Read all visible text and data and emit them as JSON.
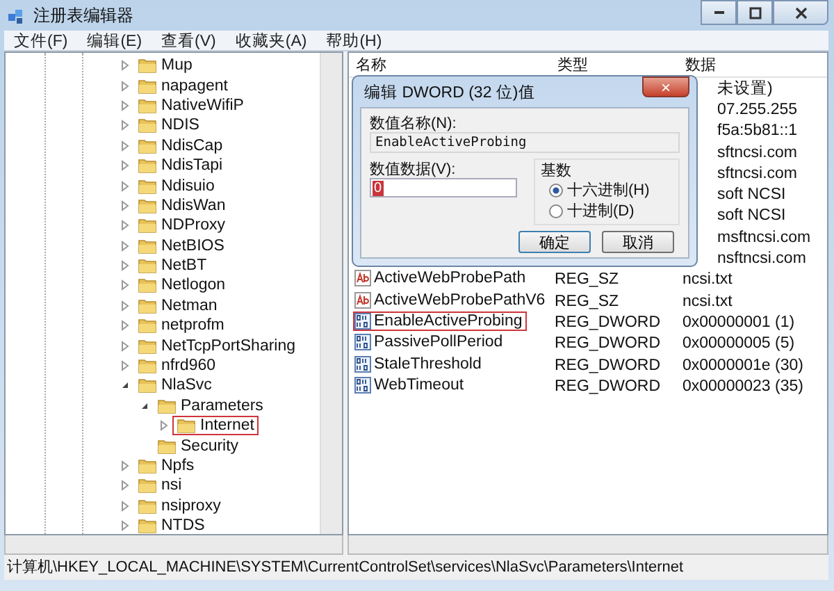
{
  "window": {
    "title": "注册表编辑器"
  },
  "menu": [
    "文件(F)",
    "编辑(E)",
    "查看(V)",
    "收藏夹(A)",
    "帮助(H)"
  ],
  "tree": [
    {
      "label": "Mup",
      "expanded": false
    },
    {
      "label": "napagent",
      "expanded": false
    },
    {
      "label": "NativeWifiP",
      "expanded": false
    },
    {
      "label": "NDIS",
      "expanded": false
    },
    {
      "label": "NdisCap",
      "expanded": false
    },
    {
      "label": "NdisTapi",
      "expanded": false
    },
    {
      "label": "Ndisuio",
      "expanded": false
    },
    {
      "label": "NdisWan",
      "expanded": false
    },
    {
      "label": "NDProxy",
      "expanded": false
    },
    {
      "label": "NetBIOS",
      "expanded": false
    },
    {
      "label": "NetBT",
      "expanded": false
    },
    {
      "label": "Netlogon",
      "expanded": false
    },
    {
      "label": "Netman",
      "expanded": false
    },
    {
      "label": "netprofm",
      "expanded": false
    },
    {
      "label": "NetTcpPortSharing",
      "expanded": false
    },
    {
      "label": "nfrd960",
      "expanded": false
    },
    {
      "label": "NlaSvc",
      "expanded": true,
      "children": [
        {
          "label": "Parameters",
          "expanded": true,
          "children": [
            {
              "label": "Internet",
              "expanded": false,
              "highlighted": true
            }
          ]
        },
        {
          "label": "Security"
        }
      ]
    },
    {
      "label": "Npfs",
      "expanded": false
    },
    {
      "label": "nsi",
      "expanded": false
    },
    {
      "label": "nsiproxy",
      "expanded": false
    },
    {
      "label": "NTDS",
      "expanded": false
    }
  ],
  "table": {
    "columns": [
      "名称",
      "类型",
      "数据"
    ],
    "rows": [
      {
        "data": "未设置)"
      },
      {
        "data": "07.255.255"
      },
      {
        "data": "f5a:5b81::1"
      },
      {
        "data": "sftncsi.com"
      },
      {
        "data": "sftncsi.com"
      },
      {
        "data": "soft NCSI"
      },
      {
        "data": "soft NCSI"
      },
      {
        "data": "msftncsi.com"
      },
      {
        "data": "nsftncsi.com"
      },
      {
        "kind": "string",
        "name": "ActiveWebProbePath",
        "type": "REG_SZ",
        "data": "ncsi.txt",
        "highlighted": false
      },
      {
        "kind": "string",
        "name": "ActiveWebProbePathV6",
        "type": "REG_SZ",
        "data": "ncsi.txt",
        "highlighted": false
      },
      {
        "kind": "number",
        "name": "EnableActiveProbing",
        "type": "REG_DWORD",
        "data": "0x00000001 (1)",
        "highlighted": true
      },
      {
        "kind": "number",
        "name": "PassivePollPeriod",
        "type": "REG_DWORD",
        "data": "0x00000005 (5)",
        "highlighted": false
      },
      {
        "kind": "number",
        "name": "StaleThreshold",
        "type": "REG_DWORD",
        "data": "0x0000001e (30)",
        "highlighted": false
      },
      {
        "kind": "number",
        "name": "WebTimeout",
        "type": "REG_DWORD",
        "data": "0x00000023 (35)",
        "highlighted": false
      }
    ]
  },
  "dialog": {
    "title": "编辑 DWORD (32 位)值",
    "close": "×",
    "name_label": "数值名称(N):",
    "name_value": "EnableActiveProbing",
    "data_label": "数值数据(V):",
    "data_value": "0",
    "base_label": "基数",
    "bases": [
      {
        "label": "十六进制(H)",
        "selected": true
      },
      {
        "label": "十进制(D)",
        "selected": false
      }
    ],
    "buttons": [
      "确定",
      "取消"
    ]
  },
  "status_bar": "计算机\\HKEY_LOCAL_MACHINE\\SYSTEM\\CurrentControlSet\\services\\NlaSvc\\Parameters\\Internet"
}
